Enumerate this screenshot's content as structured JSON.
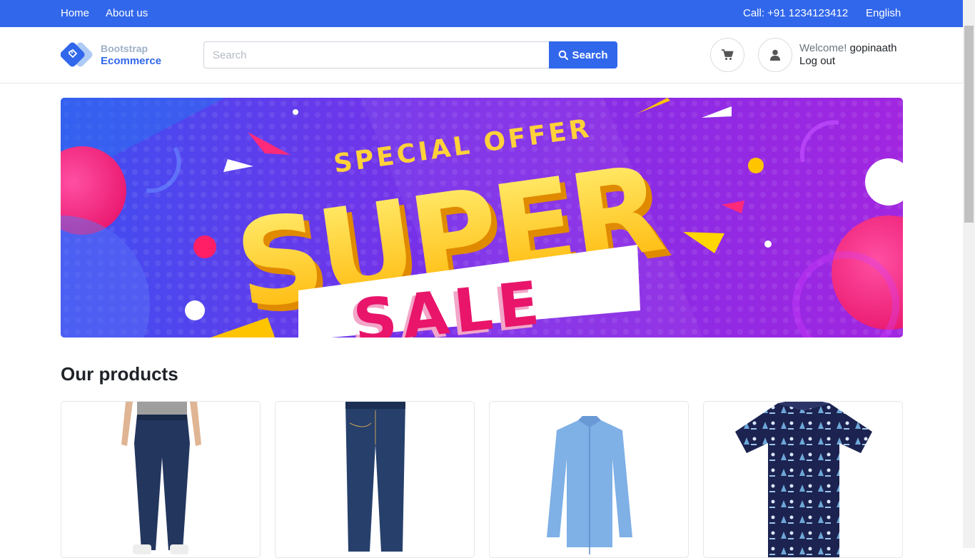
{
  "topbar": {
    "home": "Home",
    "about": "About us",
    "call": "Call: +91 1234123412",
    "language": "English"
  },
  "logo": {
    "line1": "Bootstrap",
    "line2": "Ecommerce"
  },
  "search": {
    "placeholder": "Search",
    "value": "",
    "button": "Search"
  },
  "user": {
    "welcome": "Welcome!",
    "name": "gopinaath",
    "logout": "Log out"
  },
  "banner": {
    "line1": "SPECIAL OFFER",
    "line2": "SUPER",
    "line3": "SALE"
  },
  "products": {
    "title": "Our products",
    "items": [
      {
        "image": "jeans-on-model"
      },
      {
        "image": "dark-jeans"
      },
      {
        "image": "light-blue-shirt"
      },
      {
        "image": "printed-shirt"
      }
    ]
  },
  "colors": {
    "primary": "#3167eb"
  }
}
